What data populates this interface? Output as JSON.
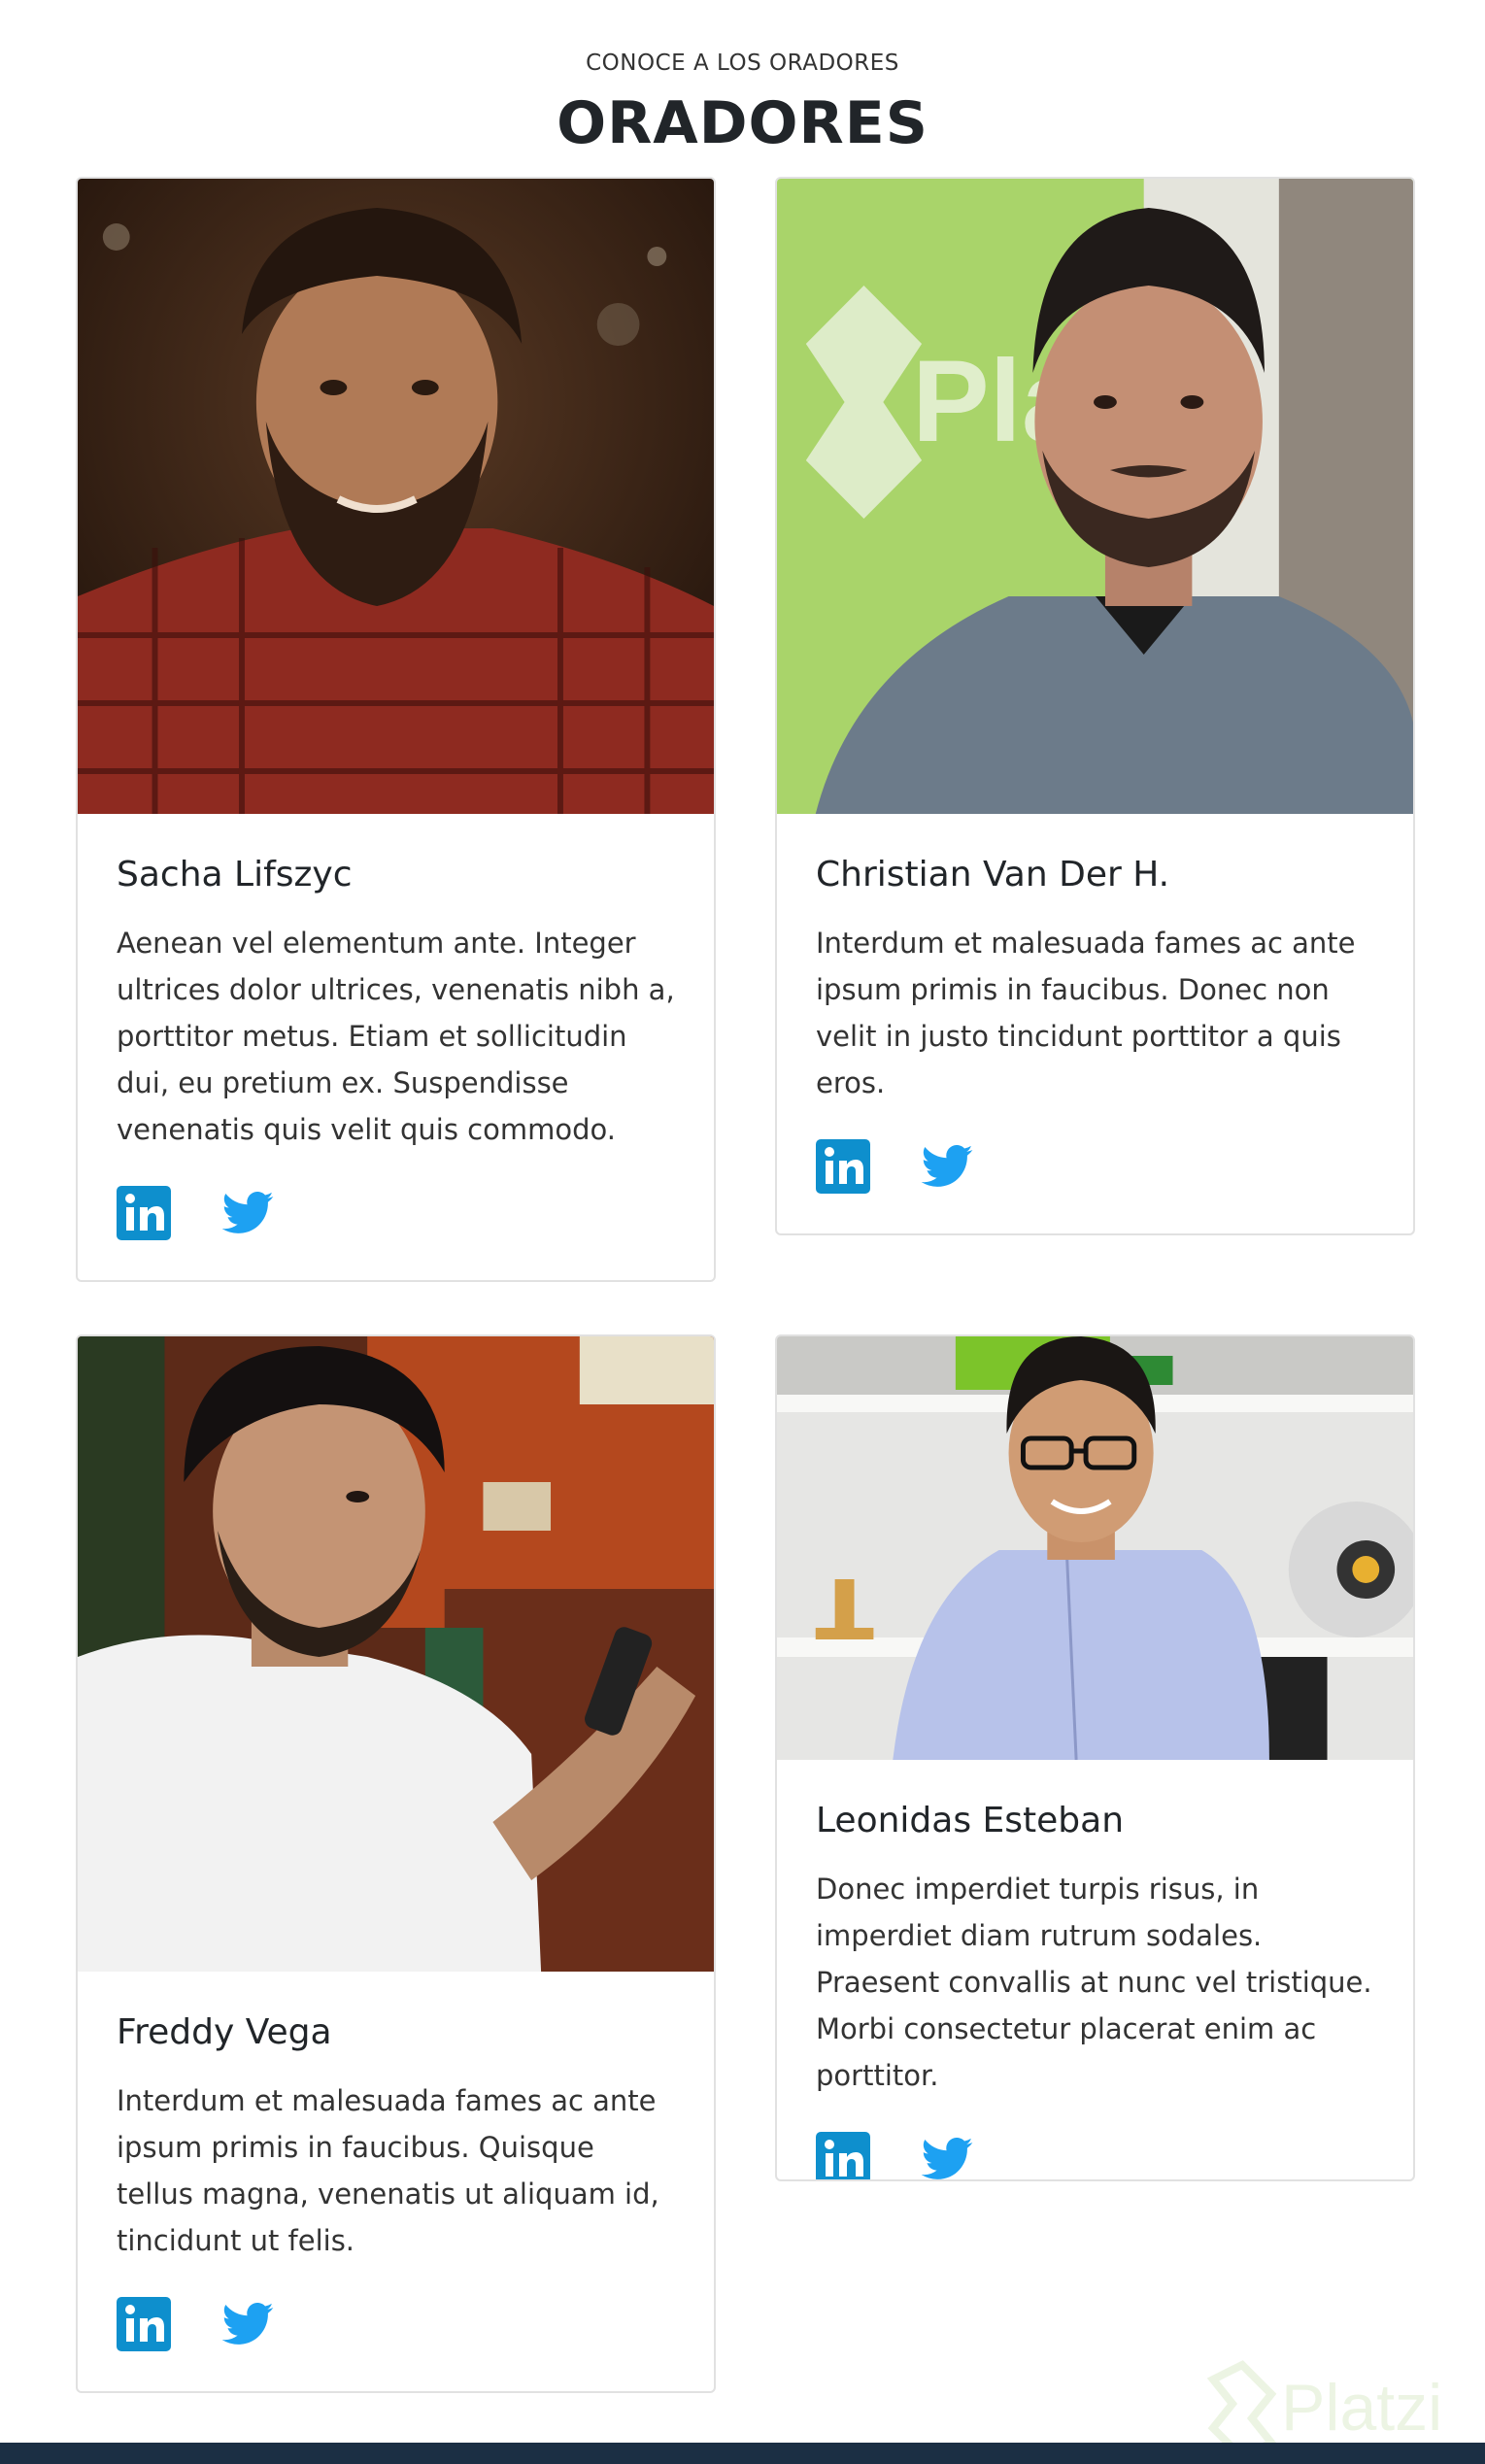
{
  "header": {
    "subtitle": "CONOCE A LOS ORADORES",
    "title": "ORADORES"
  },
  "speakers": [
    {
      "name": "Sacha Lifszyc",
      "bio": "Aenean vel elementum ante. Integer ultrices dolor ultrices, venenatis nibh a, porttitor metus. Etiam et sollicitudin dui, eu pretium ex. Suspendisse venenatis quis velit quis commodo.",
      "photo_alt": "Sacha Lifszyc"
    },
    {
      "name": "Christian Van Der H.",
      "bio": "Interdum et malesuada fames ac ante ipsum primis in faucibus. Donec non velit in justo tincidunt porttitor a quis eros.",
      "photo_alt": "Christian Van Der H.",
      "photo_sign": "Platzi"
    },
    {
      "name": "Freddy Vega",
      "bio": "Interdum et malesuada fames ac ante ipsum primis in faucibus. Quisque tellus magna, venenatis ut aliquam id, tincidunt ut felis.",
      "photo_alt": "Freddy Vega"
    },
    {
      "name": "Leonidas Esteban",
      "bio": "Donec imperdiet turpis risus, in imperdiet diam rutrum sodales. Praesent convallis at nunc vel tristique. Morbi consectetur placerat enim ac porttitor.",
      "photo_alt": "Leonidas Esteban"
    }
  ],
  "social": {
    "linkedin_icon": "linkedin-icon",
    "twitter_icon": "twitter-icon",
    "linkedin_color": "#0e8fcd",
    "twitter_color": "#1da1f2"
  },
  "watermark": {
    "text": "Platzi"
  },
  "colors": {
    "footer": "#1b2f44",
    "card_border": "#e1e1e1"
  }
}
